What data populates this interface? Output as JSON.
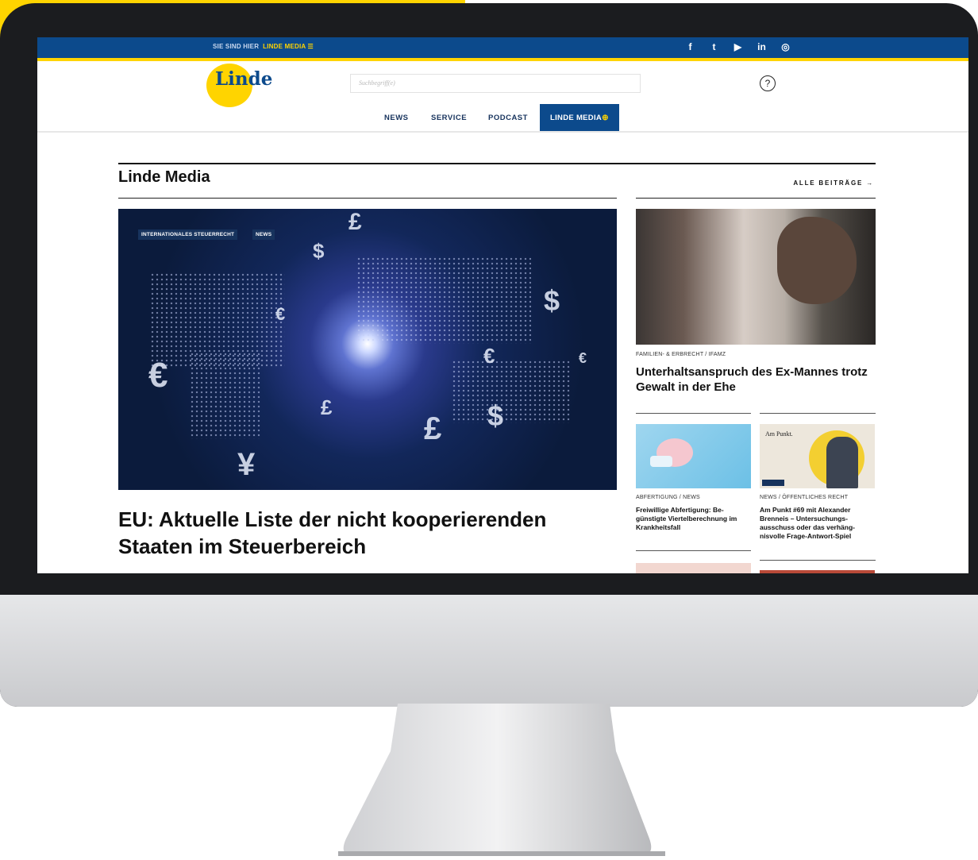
{
  "topbar": {
    "breadcrumb_prefix": "SIE SIND HIER",
    "breadcrumb_current": "LINDE MEDIA ☰"
  },
  "social": [
    "f",
    "t",
    "▶",
    "in",
    "◎"
  ],
  "logo": {
    "text": "Linde"
  },
  "search": {
    "placeholder": "Suchbegriff(e)"
  },
  "help_icon": "?",
  "nav": {
    "items": [
      "NEWS",
      "SERVICE",
      "PODCAST"
    ],
    "active": "LINDE MEDIA",
    "active_icon": "⊕"
  },
  "section": {
    "title": "Linde Media",
    "all_link": "ALLE BEITRÄGE →"
  },
  "feature": {
    "tags": [
      "INTERNATIONALES STEUERRECHT",
      "NEWS"
    ],
    "title": "EU: Aktuelle Liste der nicht kooperierenden Staaten im Steuerbereich"
  },
  "side_article": {
    "category": "FAMILIEN- & ERBRECHT / IFAMZ",
    "title": "Unterhaltsanspruch des Ex-Mannes trotz Gewalt in der Ehe"
  },
  "small_articles": [
    {
      "category": "ABFERTIGUNG / NEWS",
      "title": "Freiwillige Abfertigung: Be­günstigte Viertelberechnung im Krankheitsfall"
    },
    {
      "category": "NEWS / ÖFFENTLICHES RECHT",
      "title": "Am Punkt #69 mit Alexander Brenneis – Untersuchungs­ausschuss oder das verhäng­nisvolle Frage-Antwort-Spiel",
      "thumb_text": "Am Punkt."
    }
  ],
  "colors": {
    "brand_blue": "#0c4a8c",
    "brand_yellow": "#ffd400",
    "nav_text": "#17335d"
  }
}
